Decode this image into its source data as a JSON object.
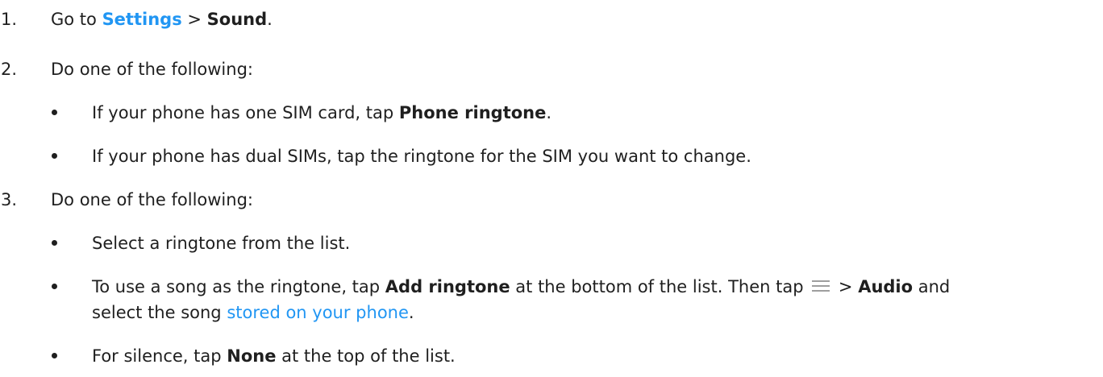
{
  "steps": [
    {
      "number": "1.",
      "prefix": "Go to ",
      "settings_link": "Settings",
      "separator": " > ",
      "sound": "Sound",
      "end": "."
    },
    {
      "number": "2.",
      "text": "Do one of the following:",
      "bullets": [
        {
          "prefix": "If your phone has one SIM card, tap ",
          "bold": "Phone ringtone",
          "end": "."
        },
        {
          "text": "If your phone has dual SIMs, tap the ringtone for the SIM you want to change."
        }
      ]
    },
    {
      "number": "3.",
      "text": "Do one of the following:",
      "bullets": [
        {
          "text": "Select a ringtone from the list."
        },
        {
          "prefix": "To use a song as the ringtone, tap ",
          "bold": "Add ringtone",
          "middle": " at the bottom of the list. Then tap ",
          "icon": "menu-icon",
          "separator": " > ",
          "bold2": "Audio",
          "after": " and",
          "line2_prefix": "select the song ",
          "link": "stored on your phone",
          "end": "."
        },
        {
          "prefix": "For silence, tap ",
          "bold": "None",
          "end": " at the top of the list."
        }
      ]
    }
  ]
}
